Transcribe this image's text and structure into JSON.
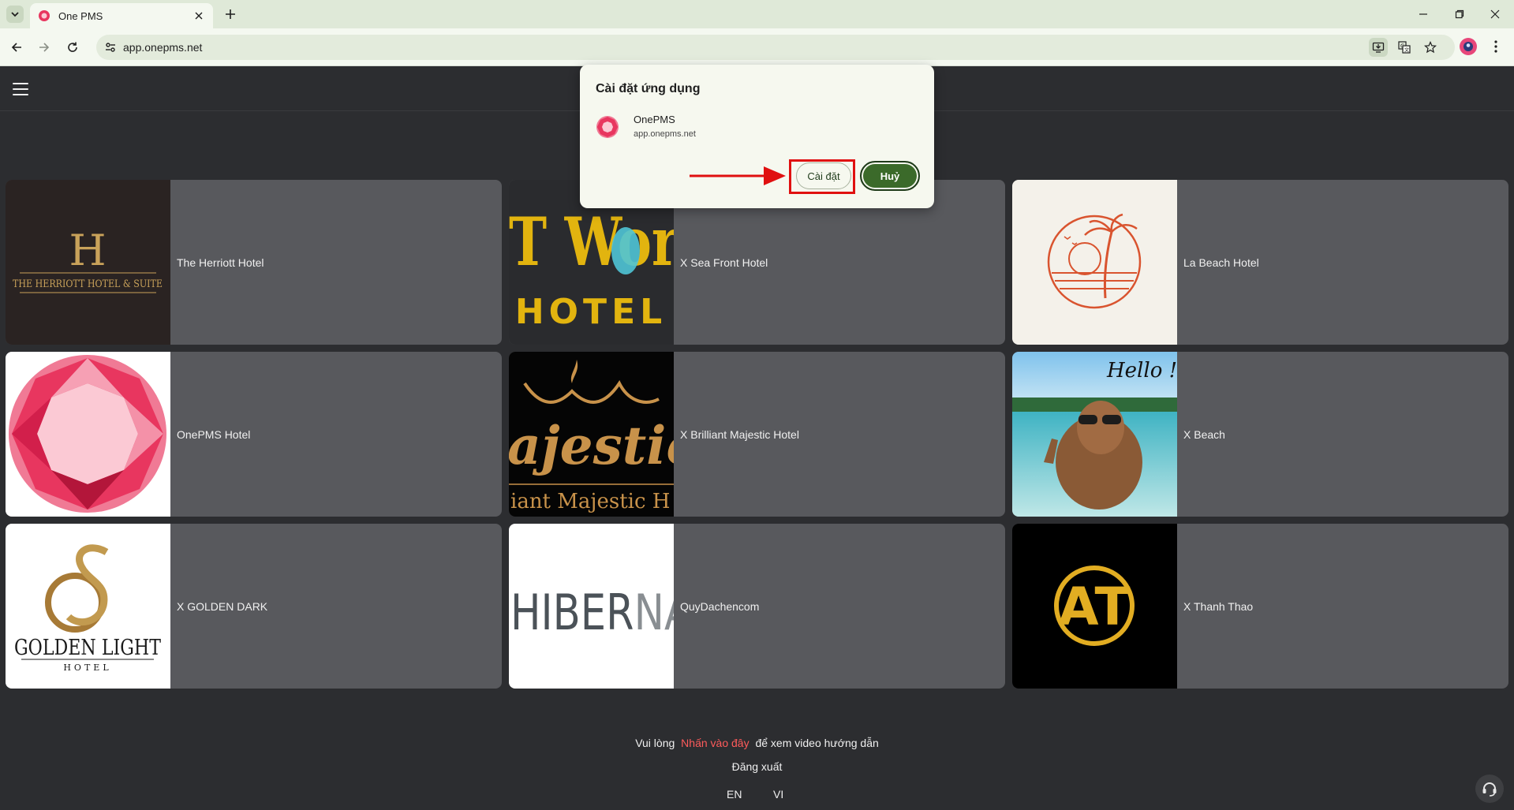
{
  "browser": {
    "tab_title": "One PMS",
    "url": "app.onepms.net"
  },
  "install_dialog": {
    "title": "Cài đặt ứng dụng",
    "app_name": "OnePMS",
    "app_url": "app.onepms.net",
    "install_label": "Cài đặt",
    "cancel_label": "Huỷ"
  },
  "hotels": [
    {
      "name": "The Herriott Hotel",
      "logo": "herriott-logo"
    },
    {
      "name": "X Sea Front Hotel",
      "logo": "t-world-hotel-logo"
    },
    {
      "name": "La Beach Hotel",
      "logo": "palm-beach-logo"
    },
    {
      "name": "OnePMS Hotel",
      "logo": "ruby-gem-logo"
    },
    {
      "name": "X Brilliant Majestic Hotel",
      "logo": "majestic-crown-logo"
    },
    {
      "name": "X Beach",
      "logo": "capybara-hello-photo"
    },
    {
      "name": "X GOLDEN DARK",
      "logo": "golden-light-logo"
    },
    {
      "name": "QuyDachencom",
      "logo": "hiberna-logo"
    },
    {
      "name": "X Thanh Thao",
      "logo": "at-monogram-logo"
    }
  ],
  "logo_text": {
    "herriott_letter": "H",
    "herriott_name": "THE HERRIOTT HOTEL & SUITE",
    "tworld": "T Wor",
    "tworld_sub": "HOTEL",
    "majestic": "ajestic",
    "majestic_sub": "iant Majestic H",
    "hello": "Hello !",
    "golden_name": "GOLDEN LIGHT",
    "golden_sub": "HOTEL",
    "hiberna": "HIBERNA",
    "at": "AT"
  },
  "footer": {
    "prefix": "Vui lòng",
    "link": "Nhấn vào đây",
    "suffix": "để xem video hướng dẫn",
    "logout": "Đăng xuất",
    "lang_en": "EN",
    "lang_vi": "VI"
  },
  "colors": {
    "background": "#2c2d30",
    "card": "#58595d",
    "link": "#ff5b5b",
    "dialog_primary": "#3b6a2a",
    "highlight": "#e01010"
  }
}
